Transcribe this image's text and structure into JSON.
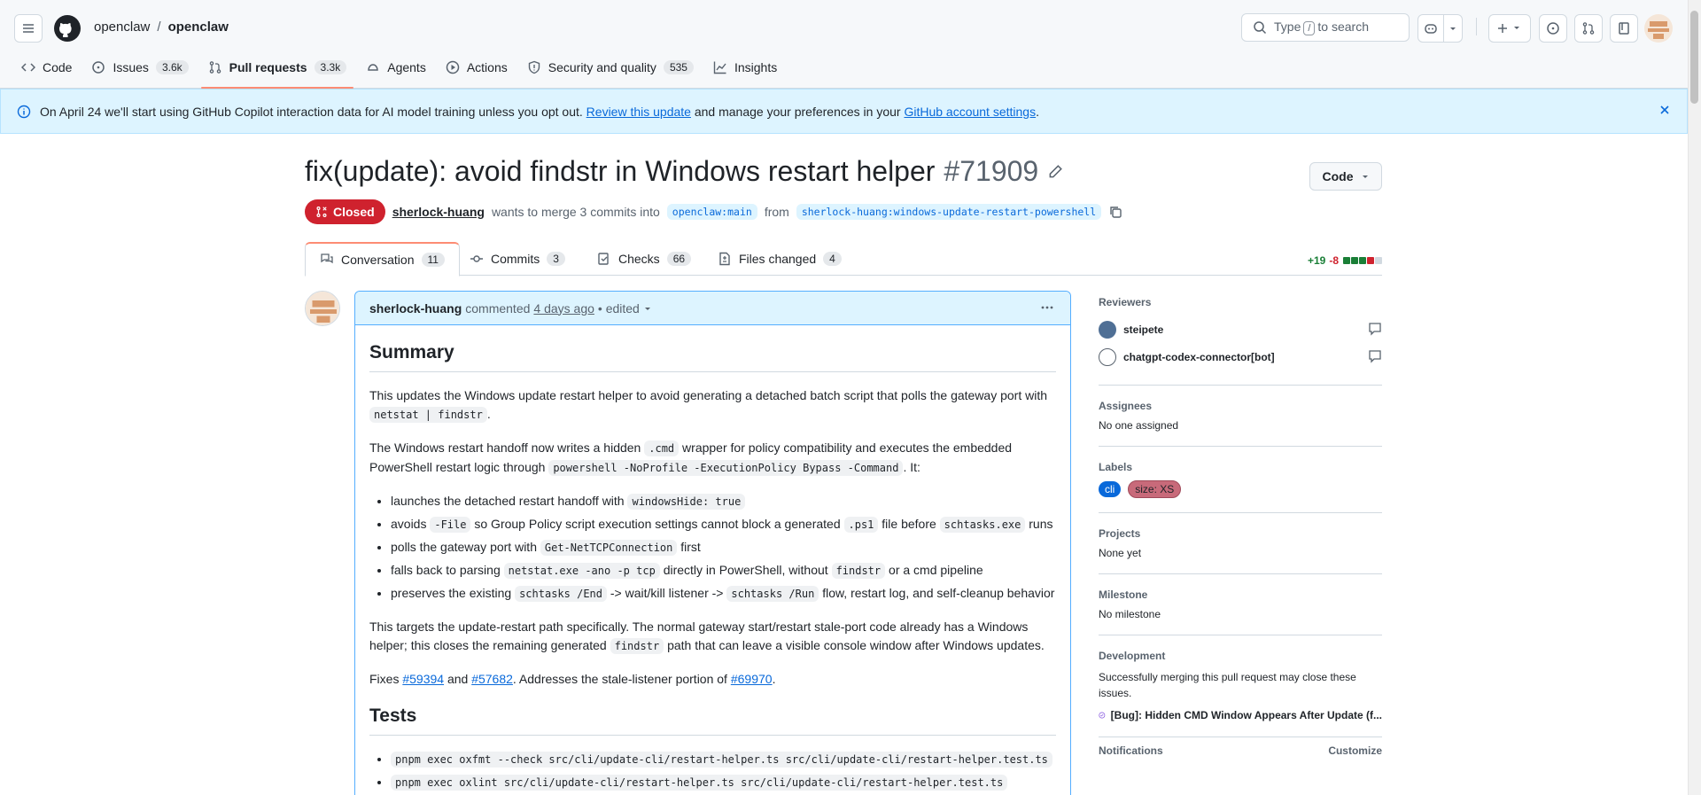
{
  "header": {
    "owner": "openclaw",
    "repo": "openclaw",
    "search_prefix": "Type",
    "search_key": "/",
    "search_suffix": "to search"
  },
  "repo_tabs": [
    {
      "label": "Code",
      "count": "",
      "icon": "code-icon"
    },
    {
      "label": "Issues",
      "count": "3.6k",
      "icon": "issue-icon"
    },
    {
      "label": "Pull requests",
      "count": "3.3k",
      "icon": "pull-request-icon"
    },
    {
      "label": "Agents",
      "count": "",
      "icon": "agents-icon"
    },
    {
      "label": "Actions",
      "count": "",
      "icon": "actions-icon"
    },
    {
      "label": "Security and quality",
      "count": "535",
      "icon": "shield-icon"
    },
    {
      "label": "Insights",
      "count": "",
      "icon": "graph-icon"
    }
  ],
  "banner": {
    "text_before": "On April 24 we'll start using GitHub Copilot interaction data for AI model training unless you opt out.",
    "link1": "Review this update",
    "text_middle": "and manage your preferences in your",
    "link2": "GitHub account settings",
    "text_after": "."
  },
  "pr": {
    "title": "fix(update): avoid findstr in Windows restart helper",
    "number": "#71909",
    "state": "Closed",
    "author": "sherlock-huang",
    "merge_text": "wants to merge 3 commits into",
    "base": "openclaw:main",
    "from_text": "from",
    "head": "sherlock-huang:windows-update-restart-powershell",
    "code_button": "Code"
  },
  "pr_tabs": [
    {
      "label": "Conversation",
      "count": "11"
    },
    {
      "label": "Commits",
      "count": "3"
    },
    {
      "label": "Checks",
      "count": "66"
    },
    {
      "label": "Files changed",
      "count": "4"
    }
  ],
  "diffstat": {
    "additions": "+19",
    "deletions": "-8"
  },
  "comment": {
    "author": "sherlock-huang",
    "action": "commented",
    "time": "4 days ago",
    "edited": "• edited",
    "summary_heading": "Summary",
    "p1_text": "This updates the Windows update restart helper to avoid generating a detached batch script that polls the gateway port with",
    "p1_code": "netstat | findstr",
    "p1_end": ".",
    "p2_a": "The Windows restart handoff now writes a hidden",
    "p2_code1": ".cmd",
    "p2_b": "wrapper for policy compatibility and executes the embedded PowerShell restart logic through",
    "p2_code2": "powershell -NoProfile -ExecutionPolicy Bypass -Command",
    "p2_c": ". It:",
    "bullets": [
      {
        "a": "launches the detached restart handoff with",
        "c1": "windowsHide: true",
        "b": "",
        "c2": "",
        "d": ""
      },
      {
        "a": "avoids",
        "c1": "-File",
        "b": "so Group Policy script execution settings cannot block a generated",
        "c2": ".ps1",
        "d": "file before",
        "c3": "schtasks.exe",
        "e": "runs"
      },
      {
        "a": "polls the gateway port with",
        "c1": "Get-NetTCPConnection",
        "b": "first",
        "c2": "",
        "d": ""
      },
      {
        "a": "falls back to parsing",
        "c1": "netstat.exe -ano -p tcp",
        "b": "directly in PowerShell, without",
        "c2": "findstr",
        "d": "or a cmd pipeline"
      },
      {
        "a": "preserves the existing",
        "c1": "schtasks /End",
        "b": "-> wait/kill listener ->",
        "c2": "schtasks /Run",
        "d": "flow, restart log, and self-cleanup behavior"
      }
    ],
    "p3_a": "This targets the update-restart path specifically. The normal gateway start/restart stale-port code already has a Windows helper; this closes the remaining generated",
    "p3_code": "findstr",
    "p3_b": "path that can leave a visible console window after Windows updates.",
    "p4_a": "Fixes",
    "p4_l1": "#59394",
    "p4_b": "and",
    "p4_l2": "#57682",
    "p4_c": ". Addresses the stale-listener portion of",
    "p4_l3": "#69970",
    "p4_d": ".",
    "tests_heading": "Tests",
    "tests": [
      "pnpm exec oxfmt --check src/cli/update-cli/restart-helper.ts src/cli/update-cli/restart-helper.test.ts",
      "pnpm exec oxlint src/cli/update-cli/restart-helper.ts src/cli/update-cli/restart-helper.test.ts"
    ]
  },
  "sidebar": {
    "reviewers_heading": "Reviewers",
    "reviewers": [
      "steipete",
      "chatgpt-codex-connector[bot]"
    ],
    "assignees_heading": "Assignees",
    "assignees_value": "No one assigned",
    "labels_heading": "Labels",
    "labels": [
      {
        "name": "cli",
        "bg": "#0969da",
        "fg": "#ffffff"
      },
      {
        "name": "size: XS",
        "bg": "#c86a7a",
        "fg": "#1f2328"
      }
    ],
    "projects_heading": "Projects",
    "projects_value": "None yet",
    "milestone_heading": "Milestone",
    "milestone_value": "No milestone",
    "development_heading": "Development",
    "development_value": "Successfully merging this pull request may close these issues.",
    "development_issue": "[Bug]: Hidden CMD Window Appears After Update (f...",
    "notifications_heading": "Notifications",
    "notifications_action": "Customize"
  },
  "colors": {
    "accent": "#0969da",
    "closed": "#cf222e",
    "tab_underline": "#fd8c73"
  }
}
